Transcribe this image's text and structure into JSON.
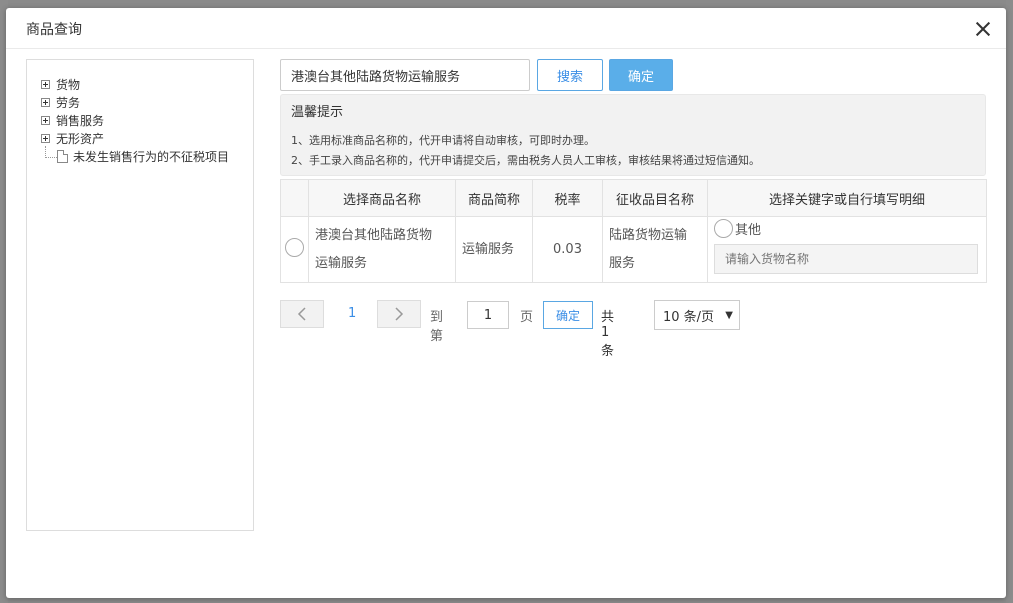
{
  "dialog": {
    "title": "商品查询"
  },
  "tree": {
    "items": [
      {
        "label": "货物"
      },
      {
        "label": "劳务"
      },
      {
        "label": "销售服务"
      },
      {
        "label": "无形资产"
      },
      {
        "label": "未发生销售行为的不征税项目"
      }
    ]
  },
  "search": {
    "value": "港澳台其他陆路货物运输服务",
    "search_label": "搜索",
    "confirm_label": "确定"
  },
  "tips": {
    "title": "温馨提示",
    "line1": "1、选用标准商品名称的，代开申请将自动审核，可即时办理。",
    "line2": "2、手工录入商品名称的，代开申请提交后，需由税务人员人工审核，审核结果将通过短信通知。"
  },
  "table": {
    "headers": [
      "选择商品名称",
      "商品简称",
      "税率",
      "征收品目名称",
      "选择关键字或自行填写明细"
    ],
    "rows": [
      {
        "name_line1": "港澳台其他陆路货物",
        "name_line2": "运输服务",
        "short": "运输服务",
        "rate": "0.03",
        "item_line1": "陆路货物运输",
        "item_line2": "服务",
        "other_label": "其他",
        "other_placeholder": "请输入货物名称"
      }
    ]
  },
  "pager": {
    "prev_icon": "chevron-left-icon",
    "next_icon": "chevron-right-icon",
    "current_page": "1",
    "goto_label": "到第",
    "goto_value": "1",
    "page_unit": "页",
    "go_label": "确定",
    "total": "共 1 条",
    "page_size": "10 条/页"
  }
}
